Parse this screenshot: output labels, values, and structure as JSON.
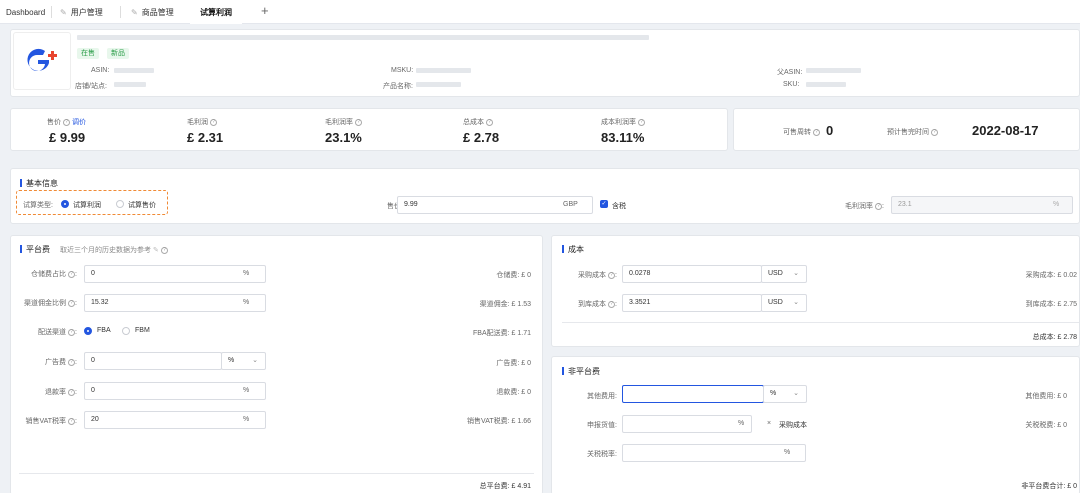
{
  "tabs": [
    {
      "label": "Dashboard"
    },
    {
      "label": "用户管理"
    },
    {
      "label": "商品管理"
    },
    {
      "label": "试算利润"
    }
  ],
  "product": {
    "tags": [
      "在售",
      "新品"
    ],
    "asin_label": "ASIN:",
    "shop_label": "店铺/站点:",
    "msku_label": "MSKU:",
    "name_label": "产品名称:",
    "parent_asin_label": "父ASIN:",
    "sku_label": "SKU:"
  },
  "summary": {
    "price_label": "售价",
    "adjust_label": "调价",
    "price_value": "£ 9.99",
    "gross_profit_label": "毛利润",
    "gross_profit_value": "£ 2.31",
    "gross_margin_label": "毛利润率",
    "gross_margin_value": "23.1%",
    "total_cost_label": "总成本",
    "total_cost_value": "£ 2.78",
    "cost_margin_label": "成本利润率",
    "cost_margin_value": "83.11%",
    "sellable_weeks_label": "可售周转",
    "sellable_weeks_value": "0",
    "expected_sellout_label": "预计售完时间",
    "expected_sellout_value": "2022-08-17"
  },
  "basic": {
    "title": "基本信息",
    "calc_type_label": "试算类型:",
    "opt_profit": "试算利润",
    "opt_price": "试算售价",
    "price_label": "售价:",
    "price_value": "9.99",
    "currency": "GBP",
    "tax_label": "含税",
    "margin_label": "毛利润率",
    "margin_value": "23.1",
    "margin_suffix": "%"
  },
  "platform": {
    "title": "平台费",
    "hint": "取近三个月的历史数据为参考",
    "storage_label": "仓储费占比",
    "storage_value": "0",
    "storage_right_label": "仓储费:",
    "storage_right_value": "£ 0",
    "commission_label": "渠道佣金比例",
    "commission_value": "15.32",
    "commission_right_label": "渠道佣金:",
    "commission_right_value": "£ 1.53",
    "channel_label": "配送渠道",
    "channel_fba": "FBA",
    "channel_fbm": "FBM",
    "fba_right_label": "FBA配送费:",
    "fba_right_value": "£ 1.71",
    "ad_label": "广告费",
    "ad_value": "0",
    "ad_unit": "%",
    "ad_right_label": "广告费:",
    "ad_right_value": "£ 0",
    "refund_label": "退款率",
    "refund_value": "0",
    "refund_right_label": "退款费:",
    "refund_right_value": "£ 0",
    "vat_label": "销售VAT税率",
    "vat_value": "20",
    "vat_right_label": "销售VAT税费:",
    "vat_right_value": "£ 1.66",
    "pct": "%",
    "total_label": "总平台费:",
    "total_value": "£ 4.91"
  },
  "cost": {
    "title": "成本",
    "purchase_label": "采购成本",
    "purchase_value": "0.0278",
    "purchase_currency": "USD",
    "purchase_right_label": "采购成本:",
    "purchase_right_value": "£ 0.02",
    "landed_label": "到库成本",
    "landed_value": "3.3521",
    "landed_currency": "USD",
    "landed_right_label": "到库成本:",
    "landed_right_value": "£ 2.75",
    "total_label": "总成本:",
    "total_value": "£ 2.78"
  },
  "nonplatform": {
    "title": "非平台费",
    "other_label": "其他费用:",
    "other_unit": "%",
    "other_right_label": "其他费用:",
    "other_right_value": "£ 0",
    "declared_label": "申报货值:",
    "declared_unit": "%",
    "declared_x": "×",
    "declared_base": "采购成本",
    "tariff_right_label": "关税税费:",
    "tariff_right_value": "£ 0",
    "tariff_label": "关税税率:",
    "tariff_unit": "%",
    "total_label": "非平台费合计:",
    "total_value": "£ 0"
  },
  "colors": {
    "accent": "#2356e0",
    "brand_red": "#e8452e",
    "dash": "#f08a35"
  }
}
